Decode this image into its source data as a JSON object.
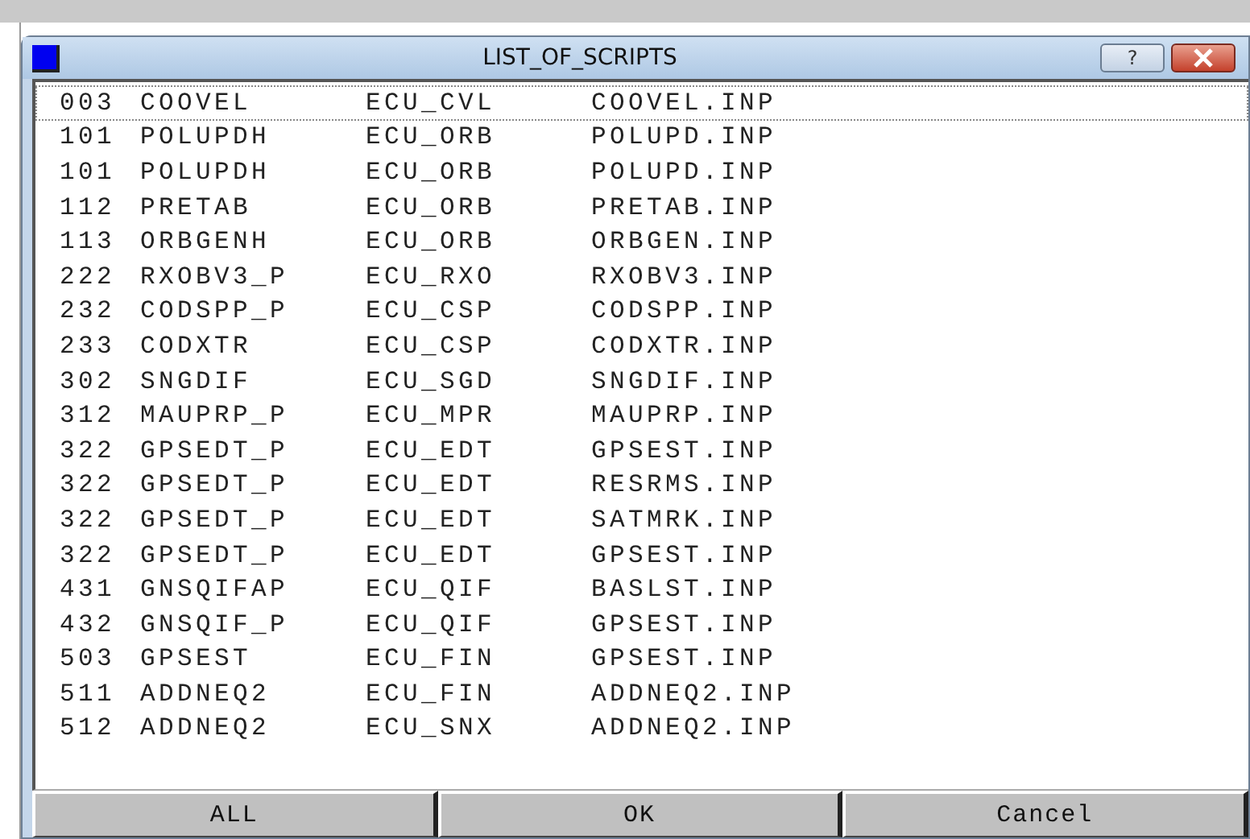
{
  "window": {
    "title": "LIST_OF_SCRIPTS",
    "help_button": "?"
  },
  "rows": [
    {
      "number": "003",
      "script": "COOVEL",
      "ecu": "ECU_CVL",
      "file": "COOVEL.INP",
      "focused": true
    },
    {
      "number": "101",
      "script": "POLUPDH",
      "ecu": "ECU_ORB",
      "file": "POLUPD.INP",
      "focused": false
    },
    {
      "number": "101",
      "script": "POLUPDH",
      "ecu": "ECU_ORB",
      "file": "POLUPD.INP",
      "focused": false
    },
    {
      "number": "112",
      "script": "PRETAB",
      "ecu": "ECU_ORB",
      "file": "PRETAB.INP",
      "focused": false
    },
    {
      "number": "113",
      "script": "ORBGENH",
      "ecu": "ECU_ORB",
      "file": "ORBGEN.INP",
      "focused": false
    },
    {
      "number": "222",
      "script": "RXOBV3_P",
      "ecu": "ECU_RXO",
      "file": "RXOBV3.INP",
      "focused": false
    },
    {
      "number": "232",
      "script": "CODSPP_P",
      "ecu": "ECU_CSP",
      "file": "CODSPP.INP",
      "focused": false
    },
    {
      "number": "233",
      "script": "CODXTR",
      "ecu": "ECU_CSP",
      "file": "CODXTR.INP",
      "focused": false
    },
    {
      "number": "302",
      "script": "SNGDIF",
      "ecu": "ECU_SGD",
      "file": "SNGDIF.INP",
      "focused": false
    },
    {
      "number": "312",
      "script": "MAUPRP_P",
      "ecu": "ECU_MPR",
      "file": "MAUPRP.INP",
      "focused": false
    },
    {
      "number": "322",
      "script": "GPSEDT_P",
      "ecu": "ECU_EDT",
      "file": "GPSEST.INP",
      "focused": false
    },
    {
      "number": "322",
      "script": "GPSEDT_P",
      "ecu": "ECU_EDT",
      "file": "RESRMS.INP",
      "focused": false
    },
    {
      "number": "322",
      "script": "GPSEDT_P",
      "ecu": "ECU_EDT",
      "file": "SATMRK.INP",
      "focused": false
    },
    {
      "number": "322",
      "script": "GPSEDT_P",
      "ecu": "ECU_EDT",
      "file": "GPSEST.INP",
      "focused": false
    },
    {
      "number": "431",
      "script": "GNSQIFAP",
      "ecu": "ECU_QIF",
      "file": "BASLST.INP",
      "focused": false
    },
    {
      "number": "432",
      "script": "GNSQIF_P",
      "ecu": "ECU_QIF",
      "file": "GPSEST.INP",
      "focused": false
    },
    {
      "number": "503",
      "script": "GPSEST",
      "ecu": "ECU_FIN",
      "file": "GPSEST.INP",
      "focused": false
    },
    {
      "number": "511",
      "script": "ADDNEQ2",
      "ecu": "ECU_FIN",
      "file": "ADDNEQ2.INP",
      "focused": false
    },
    {
      "number": "512",
      "script": "ADDNEQ2",
      "ecu": "ECU_SNX",
      "file": "ADDNEQ2.INP",
      "focused": false
    }
  ],
  "buttons": [
    "ALL",
    "OK",
    "Cancel"
  ]
}
